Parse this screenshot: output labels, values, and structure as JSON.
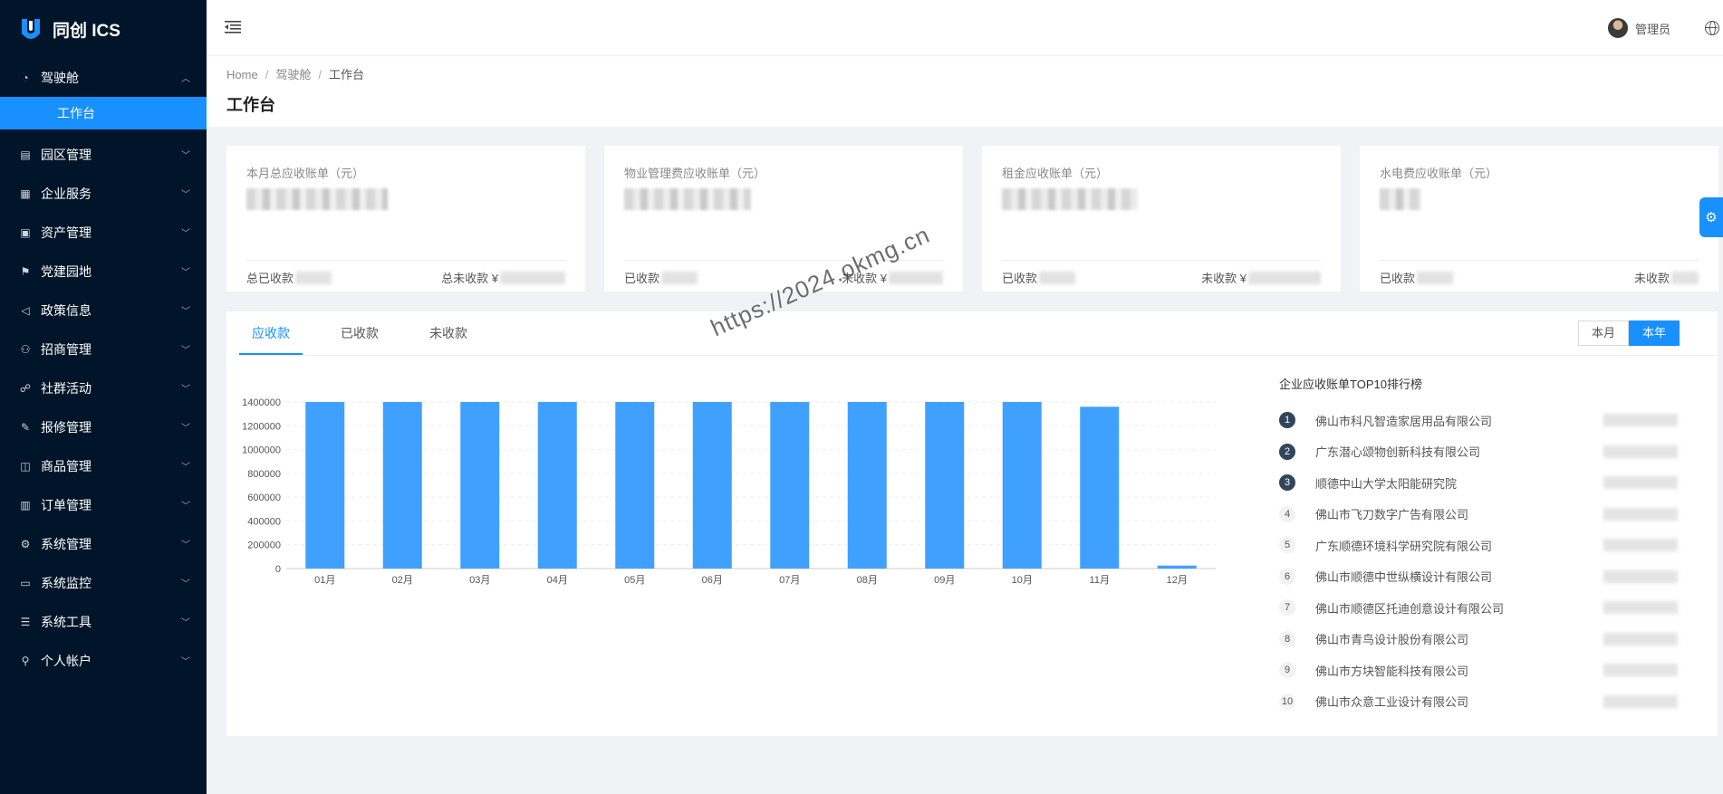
{
  "app": {
    "title": "同创 ICS"
  },
  "sidebar": {
    "items": [
      {
        "label": "驾驶舱",
        "icon": "dashboard-icon",
        "expanded": true,
        "children": [
          {
            "label": "工作台",
            "active": true
          }
        ]
      },
      {
        "label": "园区管理",
        "icon": "building-icon"
      },
      {
        "label": "企业服务",
        "icon": "apps-icon"
      },
      {
        "label": "资产管理",
        "icon": "asset-icon"
      },
      {
        "label": "党建园地",
        "icon": "flag-icon"
      },
      {
        "label": "政策信息",
        "icon": "megaphone-icon"
      },
      {
        "label": "招商管理",
        "icon": "team-icon"
      },
      {
        "label": "社群活动",
        "icon": "group-icon"
      },
      {
        "label": "报修管理",
        "icon": "wrench-icon"
      },
      {
        "label": "商品管理",
        "icon": "bag-icon"
      },
      {
        "label": "订单管理",
        "icon": "order-icon"
      },
      {
        "label": "系统管理",
        "icon": "gear-icon"
      },
      {
        "label": "系统监控",
        "icon": "monitor-icon"
      },
      {
        "label": "系统工具",
        "icon": "tool-icon"
      },
      {
        "label": "个人帐户",
        "icon": "user-icon"
      }
    ]
  },
  "header": {
    "user_name": "管理员"
  },
  "breadcrumb": {
    "home": "Home",
    "level1": "驾驶舱",
    "current": "工作台"
  },
  "page": {
    "title": "工作台"
  },
  "cards": [
    {
      "title": "本月总应收账单（元）",
      "left_label": "总已收款",
      "right_label": "总未收款 ¥"
    },
    {
      "title": "物业管理费应收账单（元）",
      "left_label": "已收款",
      "right_label": "未收款 ¥"
    },
    {
      "title": "租金应收账单（元）",
      "left_label": "已收款",
      "right_label": "未收款 ¥"
    },
    {
      "title": "水电费应收账单（元）",
      "left_label": "已收款",
      "right_label": "未收款"
    }
  ],
  "tabs": [
    {
      "label": "应收款",
      "active": true
    },
    {
      "label": "已收款",
      "active": false
    },
    {
      "label": "未收款",
      "active": false
    }
  ],
  "range": {
    "month": "本月",
    "year": "本年",
    "selected": "本年"
  },
  "chart_data": {
    "type": "bar",
    "categories": [
      "01月",
      "02月",
      "03月",
      "04月",
      "05月",
      "06月",
      "07月",
      "08月",
      "09月",
      "10月",
      "11月",
      "12月"
    ],
    "values": [
      1400000,
      1400000,
      1400000,
      1400000,
      1400000,
      1400000,
      1400000,
      1400000,
      1400000,
      1400000,
      1360000,
      25000
    ],
    "yticks": [
      0,
      200000,
      400000,
      600000,
      800000,
      1000000,
      1200000,
      1400000
    ],
    "ylim": [
      0,
      1400000
    ],
    "grid": true,
    "color": "#40a0ff"
  },
  "ranking": {
    "title": "企业应收账单TOP10排行榜",
    "items": [
      {
        "rank": "1",
        "name": "佛山市科凡智造家居用品有限公司"
      },
      {
        "rank": "2",
        "name": "广东潜心颂物创新科技有限公司"
      },
      {
        "rank": "3",
        "name": "顺德中山大学太阳能研究院"
      },
      {
        "rank": "4",
        "name": "佛山市飞刀数字广告有限公司"
      },
      {
        "rank": "5",
        "name": "广东顺德环境科学研究院有限公司"
      },
      {
        "rank": "6",
        "name": "佛山市顺德中世纵横设计有限公司"
      },
      {
        "rank": "7",
        "name": "佛山市顺德区托迪创意设计有限公司"
      },
      {
        "rank": "8",
        "name": "佛山市青鸟设计股份有限公司"
      },
      {
        "rank": "9",
        "name": "佛山市方块智能科技有限公司"
      },
      {
        "rank": "10",
        "name": "佛山市众意工业设计有限公司"
      }
    ]
  },
  "watermark": "https://2024.okmg.cn",
  "colors": {
    "primary": "#1890ff",
    "sidebar_bg": "#001529",
    "rank_top": "#314659"
  }
}
